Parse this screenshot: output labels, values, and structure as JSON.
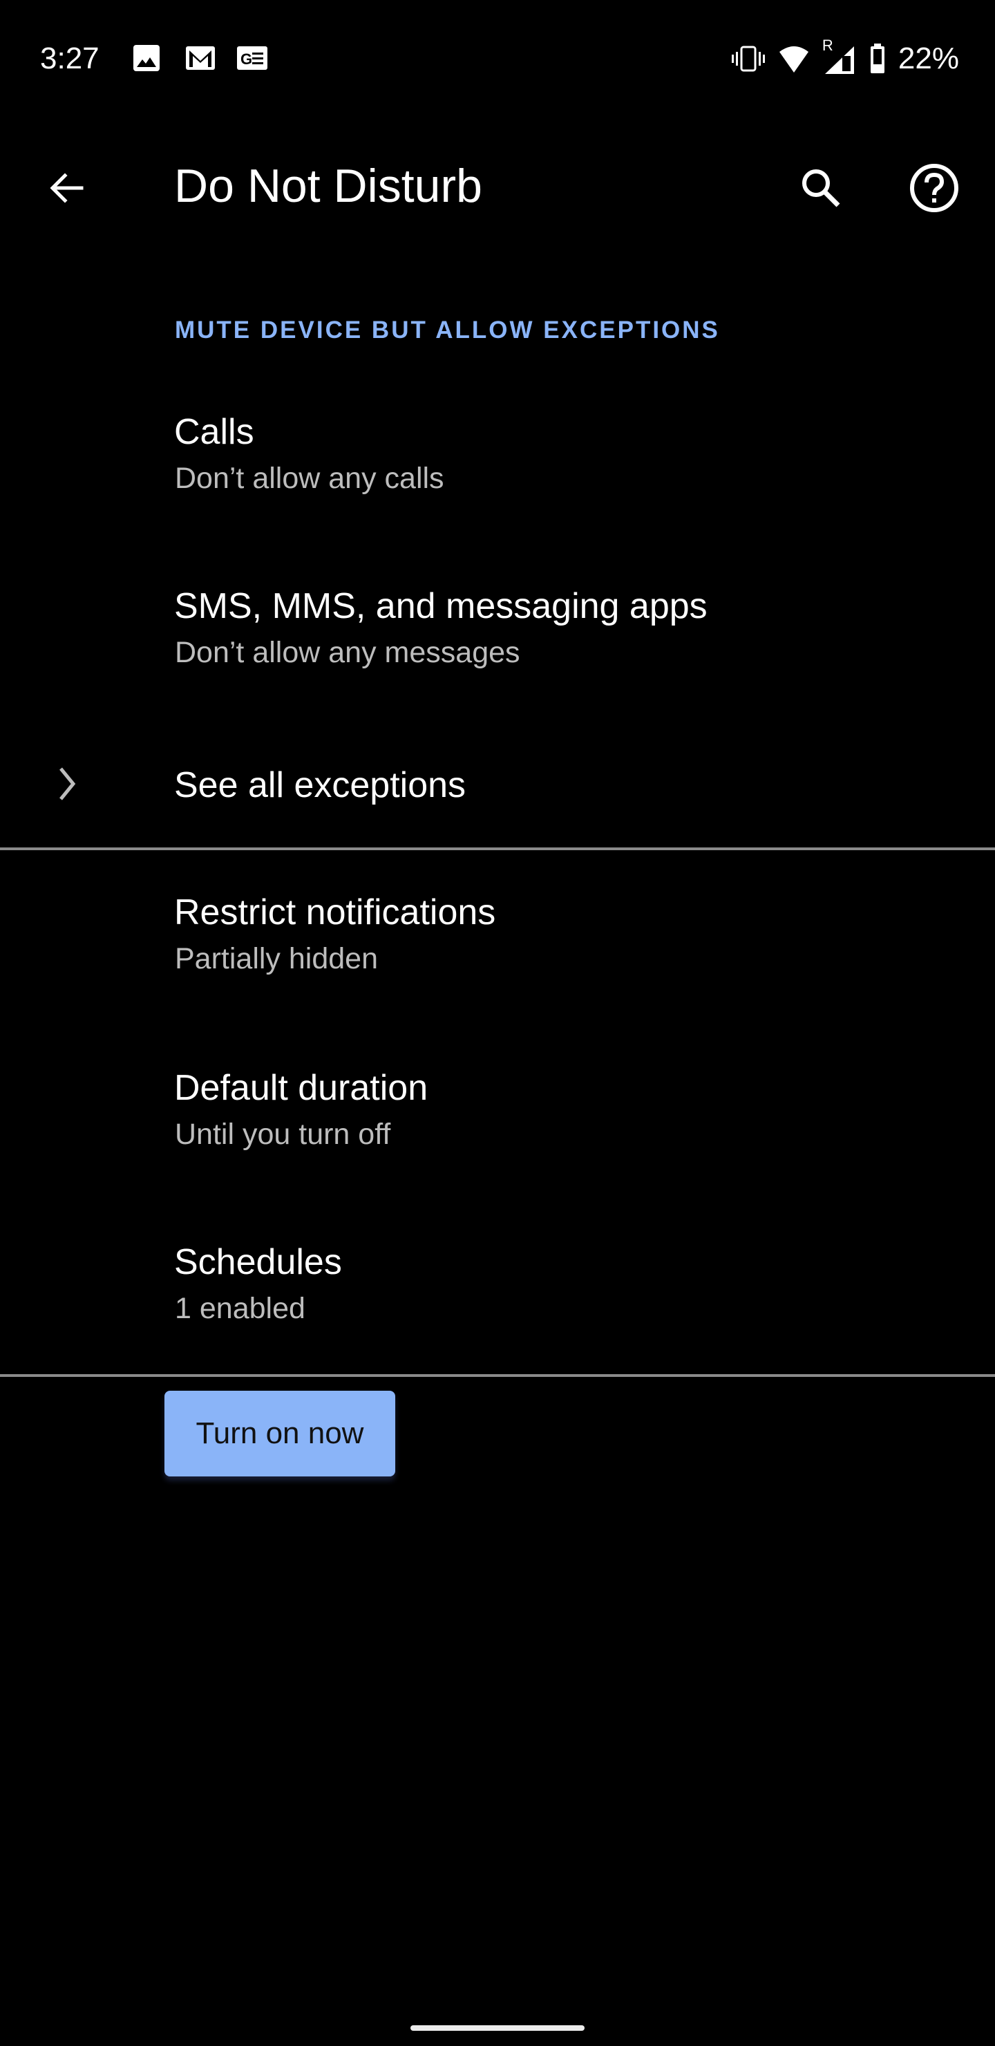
{
  "status_bar": {
    "time": "3:27",
    "notification_icons": [
      "gallery-icon",
      "gmail-icon",
      "google-news-icon"
    ],
    "system_icons": [
      "vibrate-icon",
      "wifi-icon",
      "signal-roaming-icon",
      "battery-icon"
    ],
    "roaming_indicator": "R",
    "battery_percent": "22%"
  },
  "app_bar": {
    "title": "Do Not Disturb",
    "back_icon": "arrow-back-icon",
    "search_icon": "search-icon",
    "help_icon": "help-icon"
  },
  "section": {
    "header": "MUTE DEVICE BUT ALLOW EXCEPTIONS",
    "accent_color": "#8ab4f8"
  },
  "preferences": [
    {
      "title": "Calls",
      "summary": "Don’t allow any calls"
    },
    {
      "title": "SMS, MMS, and messaging apps",
      "summary": "Don’t allow any messages"
    },
    {
      "title": "See all exceptions",
      "summary": ""
    },
    {
      "title": "Restrict notifications",
      "summary": "Partially hidden"
    },
    {
      "title": "Default duration",
      "summary": "Until you turn off"
    },
    {
      "title": "Schedules",
      "summary": "1 enabled"
    }
  ],
  "action_button": {
    "label": "Turn on now",
    "color": "#8ab4f8"
  }
}
